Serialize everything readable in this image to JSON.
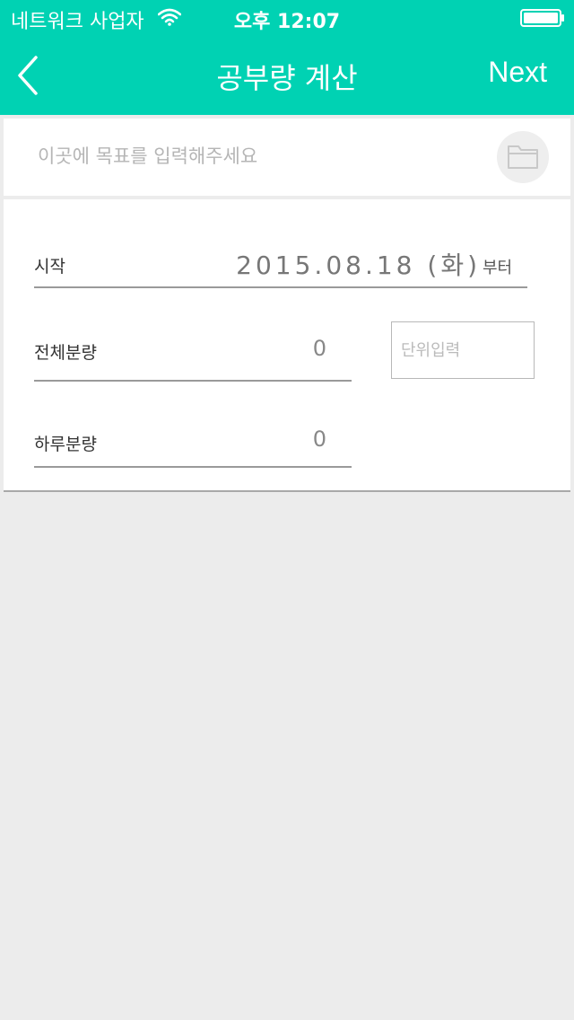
{
  "status_bar": {
    "carrier": "네트워크 사업자",
    "time": "오후 12:07",
    "wifi_icon": "wifi-icon",
    "battery_icon": "battery-icon"
  },
  "nav": {
    "back_icon": "chevron-left-icon",
    "title": "공부량 계산",
    "next_label": "Next"
  },
  "goal": {
    "placeholder": "이곳에 목표를 입력해주세요",
    "value": "",
    "folder_icon": "folder-icon"
  },
  "form": {
    "start_label": "시작",
    "start_date": "2015.08.18 (화)",
    "start_suffix": "부터",
    "total_label": "전체분량",
    "total_value": "0",
    "unit_placeholder": "단위입력",
    "daily_label": "하루분량",
    "daily_value": "0"
  },
  "colors": {
    "accent": "#00d2b3",
    "background": "#ececec"
  }
}
